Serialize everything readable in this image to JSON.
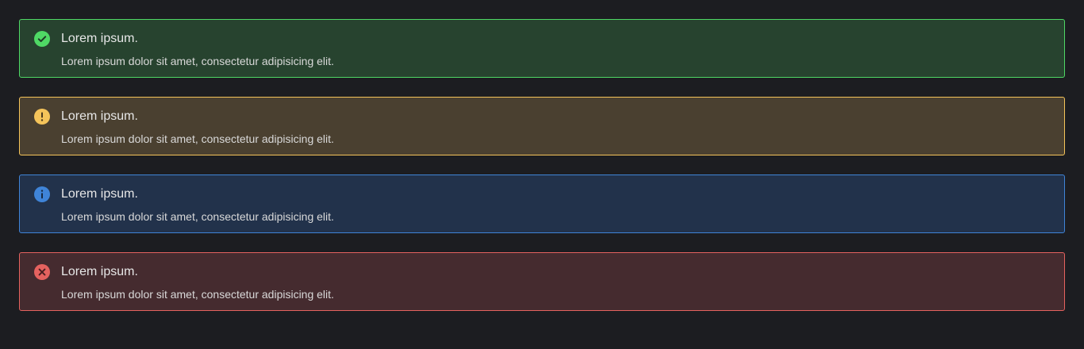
{
  "alerts": [
    {
      "type": "success",
      "icon": "check-circle-icon",
      "color": "#4fd865",
      "title": "Lorem ipsum.",
      "message": "Lorem ipsum dolor sit amet, consectetur adipisicing elit."
    },
    {
      "type": "warning",
      "icon": "exclamation-circle-icon",
      "color": "#f5c45a",
      "title": "Lorem ipsum.",
      "message": "Lorem ipsum dolor sit amet, consectetur adipisicing elit."
    },
    {
      "type": "info",
      "icon": "info-circle-icon",
      "color": "#3f84d8",
      "title": "Lorem ipsum.",
      "message": "Lorem ipsum dolor sit amet, consectetur adipisicing elit."
    },
    {
      "type": "error",
      "icon": "x-circle-icon",
      "color": "#e5625f",
      "title": "Lorem ipsum.",
      "message": "Lorem ipsum dolor sit amet, consectetur adipisicing elit."
    }
  ]
}
